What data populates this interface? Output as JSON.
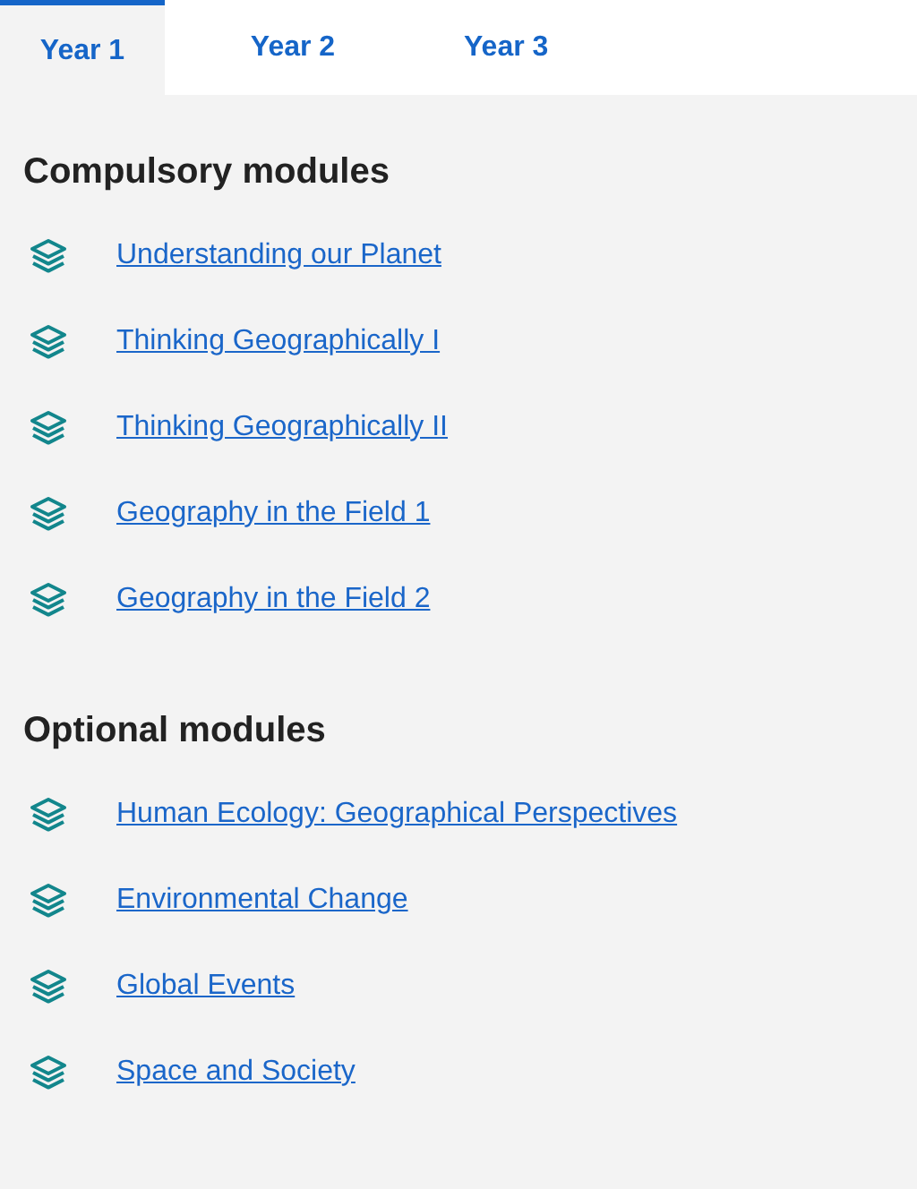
{
  "tabs": [
    {
      "label": "Year 1",
      "selected": true
    },
    {
      "label": "Year 2",
      "selected": false
    },
    {
      "label": "Year 3",
      "selected": false
    }
  ],
  "sections": [
    {
      "heading": "Compulsory modules",
      "modules": [
        "Understanding our Planet",
        "Thinking Geographically I",
        "Thinking Geographically II",
        "Geography in the Field 1",
        "Geography in the Field 2"
      ]
    },
    {
      "heading": "Optional modules",
      "modules": [
        "Human Ecology: Geographical Perspectives",
        "Environmental Change",
        "Global Events",
        "Space and Society"
      ]
    }
  ]
}
